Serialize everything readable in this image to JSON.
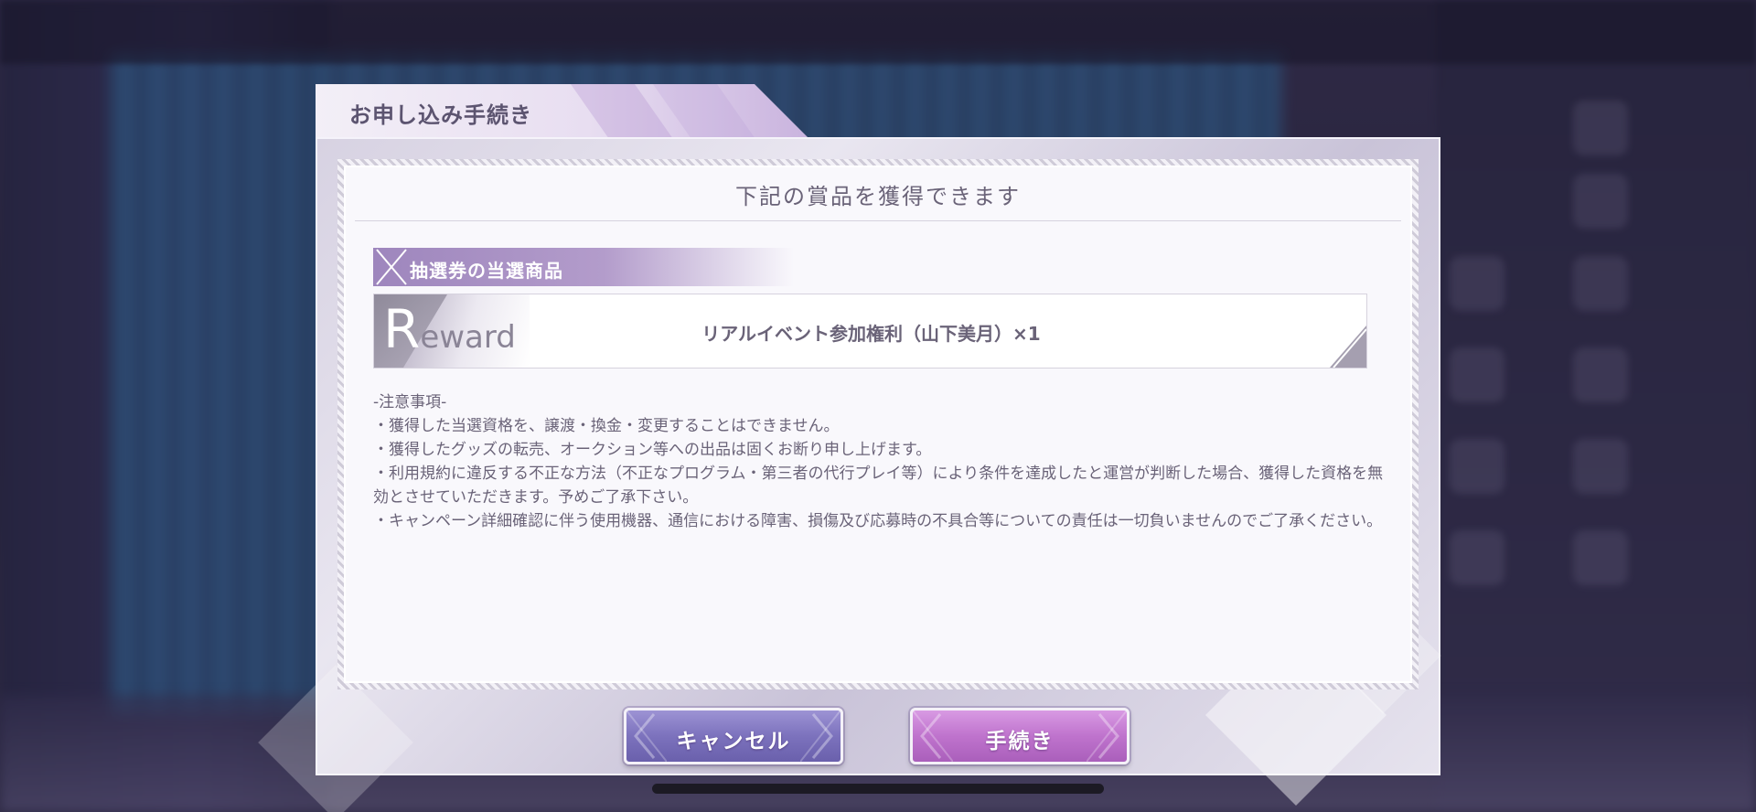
{
  "dialog": {
    "title": "お申し込み手続き",
    "heading": "下記の賞品を獲得できます",
    "section_label": "抽選券の当選商品",
    "reward_badge": {
      "initial": "R",
      "rest": "eward"
    },
    "reward_item": "リアルイベント参加権利（山下美月）×1",
    "notes": [
      "-注意事項-",
      "・獲得した当選資格を、譲渡・換金・変更することはできません。",
      "・獲得したグッズの転売、オークション等への出品は固くお断り申し上げます。",
      "・利用規約に違反する不正な方法（不正なプログラム・第三者の代行プレイ等）により条件を達成したと運営が判断した場合、獲得した資格を無効とさせていただきます。予めご了承下さい。",
      "・キャンペーン詳細確認に伴う使用機器、通信における障害、損傷及び応募時の不具合等についての責任は一切負いませんのでご了承ください。"
    ],
    "buttons": {
      "cancel": "キャンセル",
      "proceed": "手続き"
    }
  },
  "colors": {
    "accent_purple": "#9e86bd",
    "cancel_button": "#7c72bd",
    "proceed_button": "#bf73cd",
    "text": "#6a6378"
  },
  "icons": {
    "section": "x-cross-icon",
    "button_decor": "chevron-icon"
  }
}
